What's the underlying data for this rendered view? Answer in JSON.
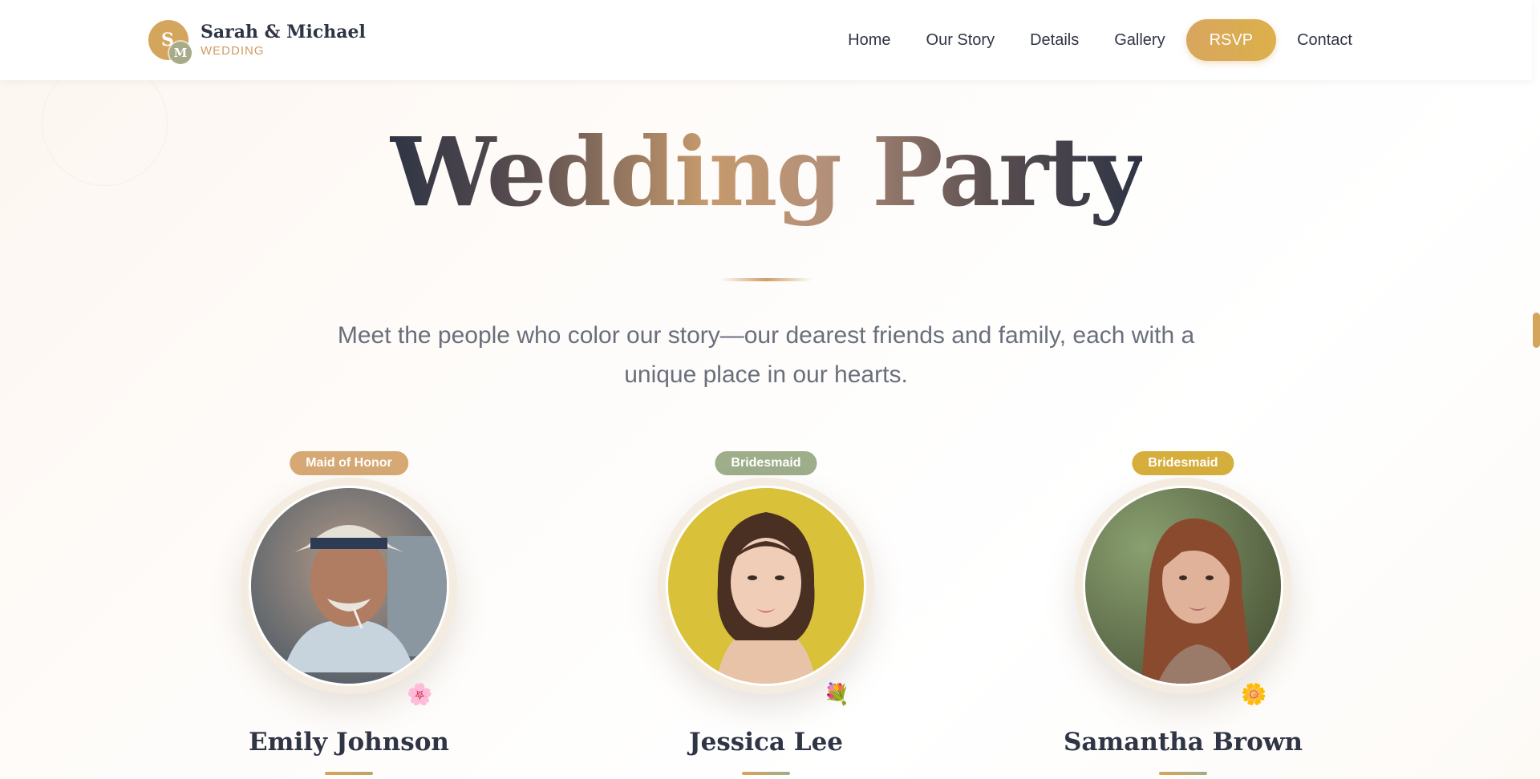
{
  "header": {
    "logo": {
      "initial_1": "S",
      "initial_2": "M",
      "title": "Sarah & Michael",
      "subtitle": "WEDDING"
    },
    "nav": [
      "Home",
      "Our Story",
      "Details",
      "Gallery",
      "RSVP",
      "Contact"
    ]
  },
  "hero": {
    "title": "Wedding Party",
    "subtitle": "Meet the people who color our story—our dearest friends and family, each with a unique place in our hearts."
  },
  "members": [
    {
      "role": "Maid of Honor",
      "name": "Emily Johnson",
      "badge_color": "#d5a874",
      "accent": "#d4a55c",
      "flower": "🌸"
    },
    {
      "role": "Bridesmaid",
      "name": "Jessica Lee",
      "badge_color": "#9eae8a",
      "accent": "#d4a55c",
      "flower": "💐"
    },
    {
      "role": "Bridesmaid",
      "name": "Samantha Brown",
      "badge_color": "#d6ae3c",
      "accent": "#b8a570",
      "flower": "🌼"
    }
  ],
  "colors": {
    "accent": "#d4a55c",
    "text": "#2f3545",
    "muted": "#6a6f7c"
  }
}
